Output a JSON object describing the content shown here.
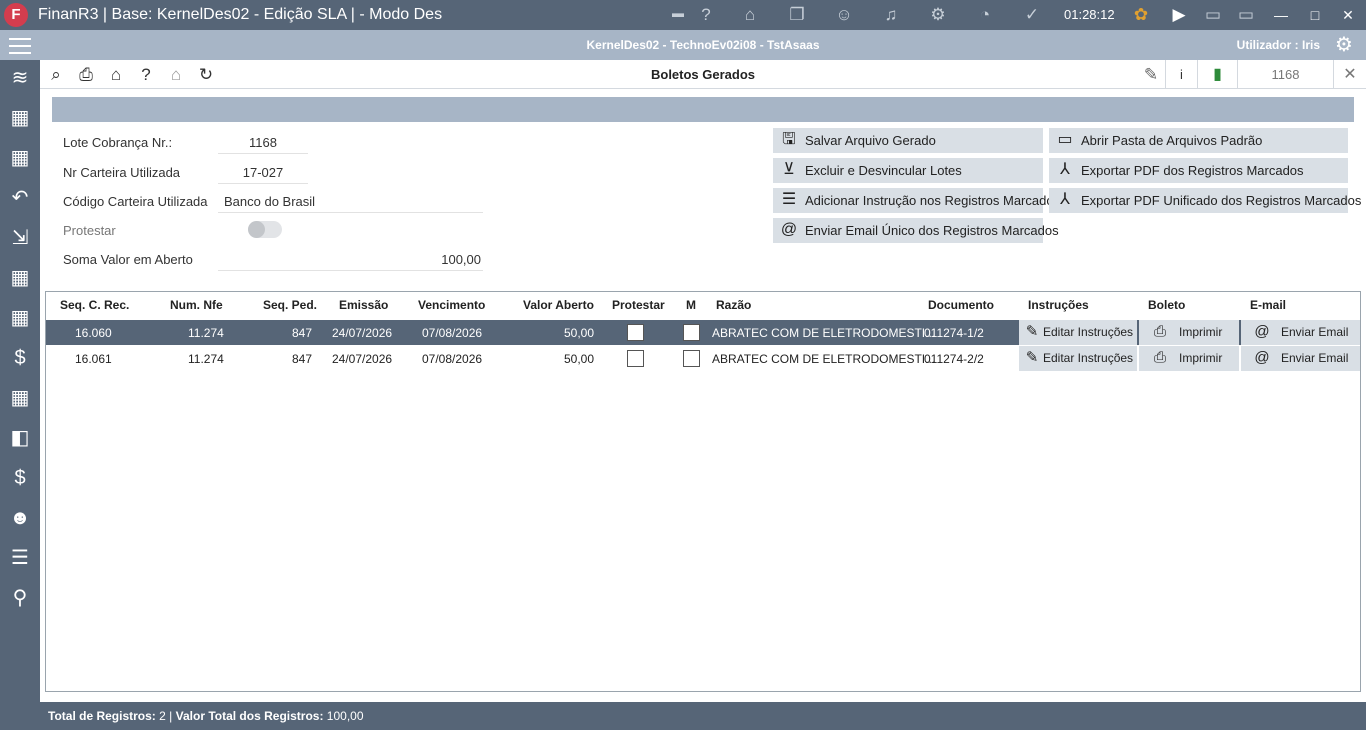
{
  "titlebar": {
    "logo_letter": "F",
    "title": "FinanR3 | Base: KernelDes02 - Edição SLA | - Modo Des",
    "clock": "01:28:12"
  },
  "infobar": {
    "session": "KernelDes02 - TechnoEv02i08 - TstAsaas",
    "user": "Utilizador : Iris"
  },
  "window": {
    "title": "Boletos Gerados",
    "info_label": "i",
    "record_number": "1168"
  },
  "form": {
    "lote_label": "Lote Cobrança Nr.:",
    "lote_value": "1168",
    "carteira_label": "Nr Carteira Utilizada",
    "carteira_value": "17-027",
    "codigo_label": "Código Carteira Utilizada",
    "codigo_value": "Banco do Brasil",
    "protestar_label": "Protestar",
    "protestar_on": false,
    "soma_label": "Soma Valor em Aberto",
    "soma_value": "100,00"
  },
  "actions": {
    "salvar": "Salvar Arquivo Gerado",
    "excluir": "Excluir e Desvincular Lotes",
    "adicionar": "Adicionar Instrução nos Registros Marcados",
    "enviar_email": "Enviar Email Único dos Registros Marcados",
    "abrir_pasta": "Abrir Pasta de Arquivos Padrão",
    "exportar_pdf": "Exportar PDF dos Registros Marcados",
    "exportar_pdf_unificado": "Exportar PDF Unificado dos Registros Marcados"
  },
  "grid": {
    "headers": {
      "seq_rec": "Seq. C. Rec.",
      "num_nfe": "Num. Nfe",
      "seq_ped": "Seq. Ped.",
      "emissao": "Emissão",
      "vencimento": "Vencimento",
      "valor": "Valor Aberto",
      "protestar": "Protestar",
      "m": "M",
      "razao": "Razão",
      "documento": "Documento",
      "instrucoes": "Instruções",
      "boleto": "Boleto",
      "email": "E-mail"
    },
    "rows": [
      {
        "seq_rec": "16.060",
        "num_nfe": "11.274",
        "seq_ped": "847",
        "emissao": "24/07/2026",
        "vencimento": "07/08/2026",
        "valor": "50,00",
        "razao": "ABRATEC COM DE ELETRODOMESTI...",
        "documento": "011274-1/2",
        "btn_instrucoes": "Editar Instruções",
        "btn_imprimir": "Imprimir",
        "btn_email": "Enviar Email"
      },
      {
        "seq_rec": "16.061",
        "num_nfe": "11.274",
        "seq_ped": "847",
        "emissao": "24/07/2026",
        "vencimento": "07/08/2026",
        "valor": "50,00",
        "razao": "ABRATEC COM DE ELETRODOMESTI...",
        "documento": "011274-2/2",
        "btn_instrucoes": "Editar Instruções",
        "btn_imprimir": "Imprimir",
        "btn_email": "Enviar Email"
      }
    ]
  },
  "footer": {
    "total_label": "Total de Registros:",
    "total_value": "2",
    "separator": "|",
    "valor_label": "Valor Total dos Registros:",
    "valor_value": "100,00"
  },
  "colors": {
    "chrome_dark": "#566577",
    "chrome_light": "#a7b5c6",
    "button_bg": "#d9dfe5",
    "logo": "#d43d4e"
  }
}
